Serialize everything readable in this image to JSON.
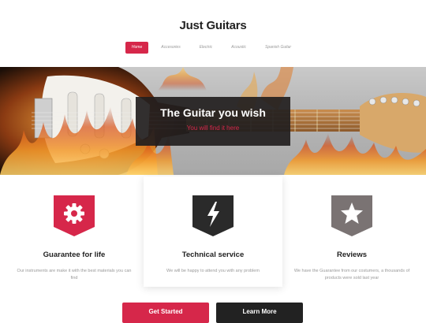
{
  "site": {
    "title": "Just Guitars"
  },
  "nav": {
    "items": [
      "Home",
      "Accesories",
      "Electric",
      "Acoustic",
      "Spanish Guitar"
    ],
    "active_index": 0
  },
  "hero": {
    "title": "The Guitar you wish",
    "subtitle": "You will find it here"
  },
  "features": [
    {
      "title": "Guarantee for life",
      "desc": "Our instruments are make it with the best materials you can find",
      "icon": "gear-icon",
      "color": "#d6274a"
    },
    {
      "title": "Technical service",
      "desc": "We will be happy to attend you with any problem",
      "icon": "lightning-icon",
      "color": "#2a2a2a"
    },
    {
      "title": "Reviews",
      "desc": "We have the Guarantee from our costumers, a thousands of products were sold last year",
      "icon": "star-icon",
      "color": "#7a7373"
    }
  ],
  "buttons": {
    "get_started": "Get Started",
    "learn_more": "Learn More"
  },
  "colors": {
    "accent": "#d6274a",
    "dark": "#222222"
  }
}
